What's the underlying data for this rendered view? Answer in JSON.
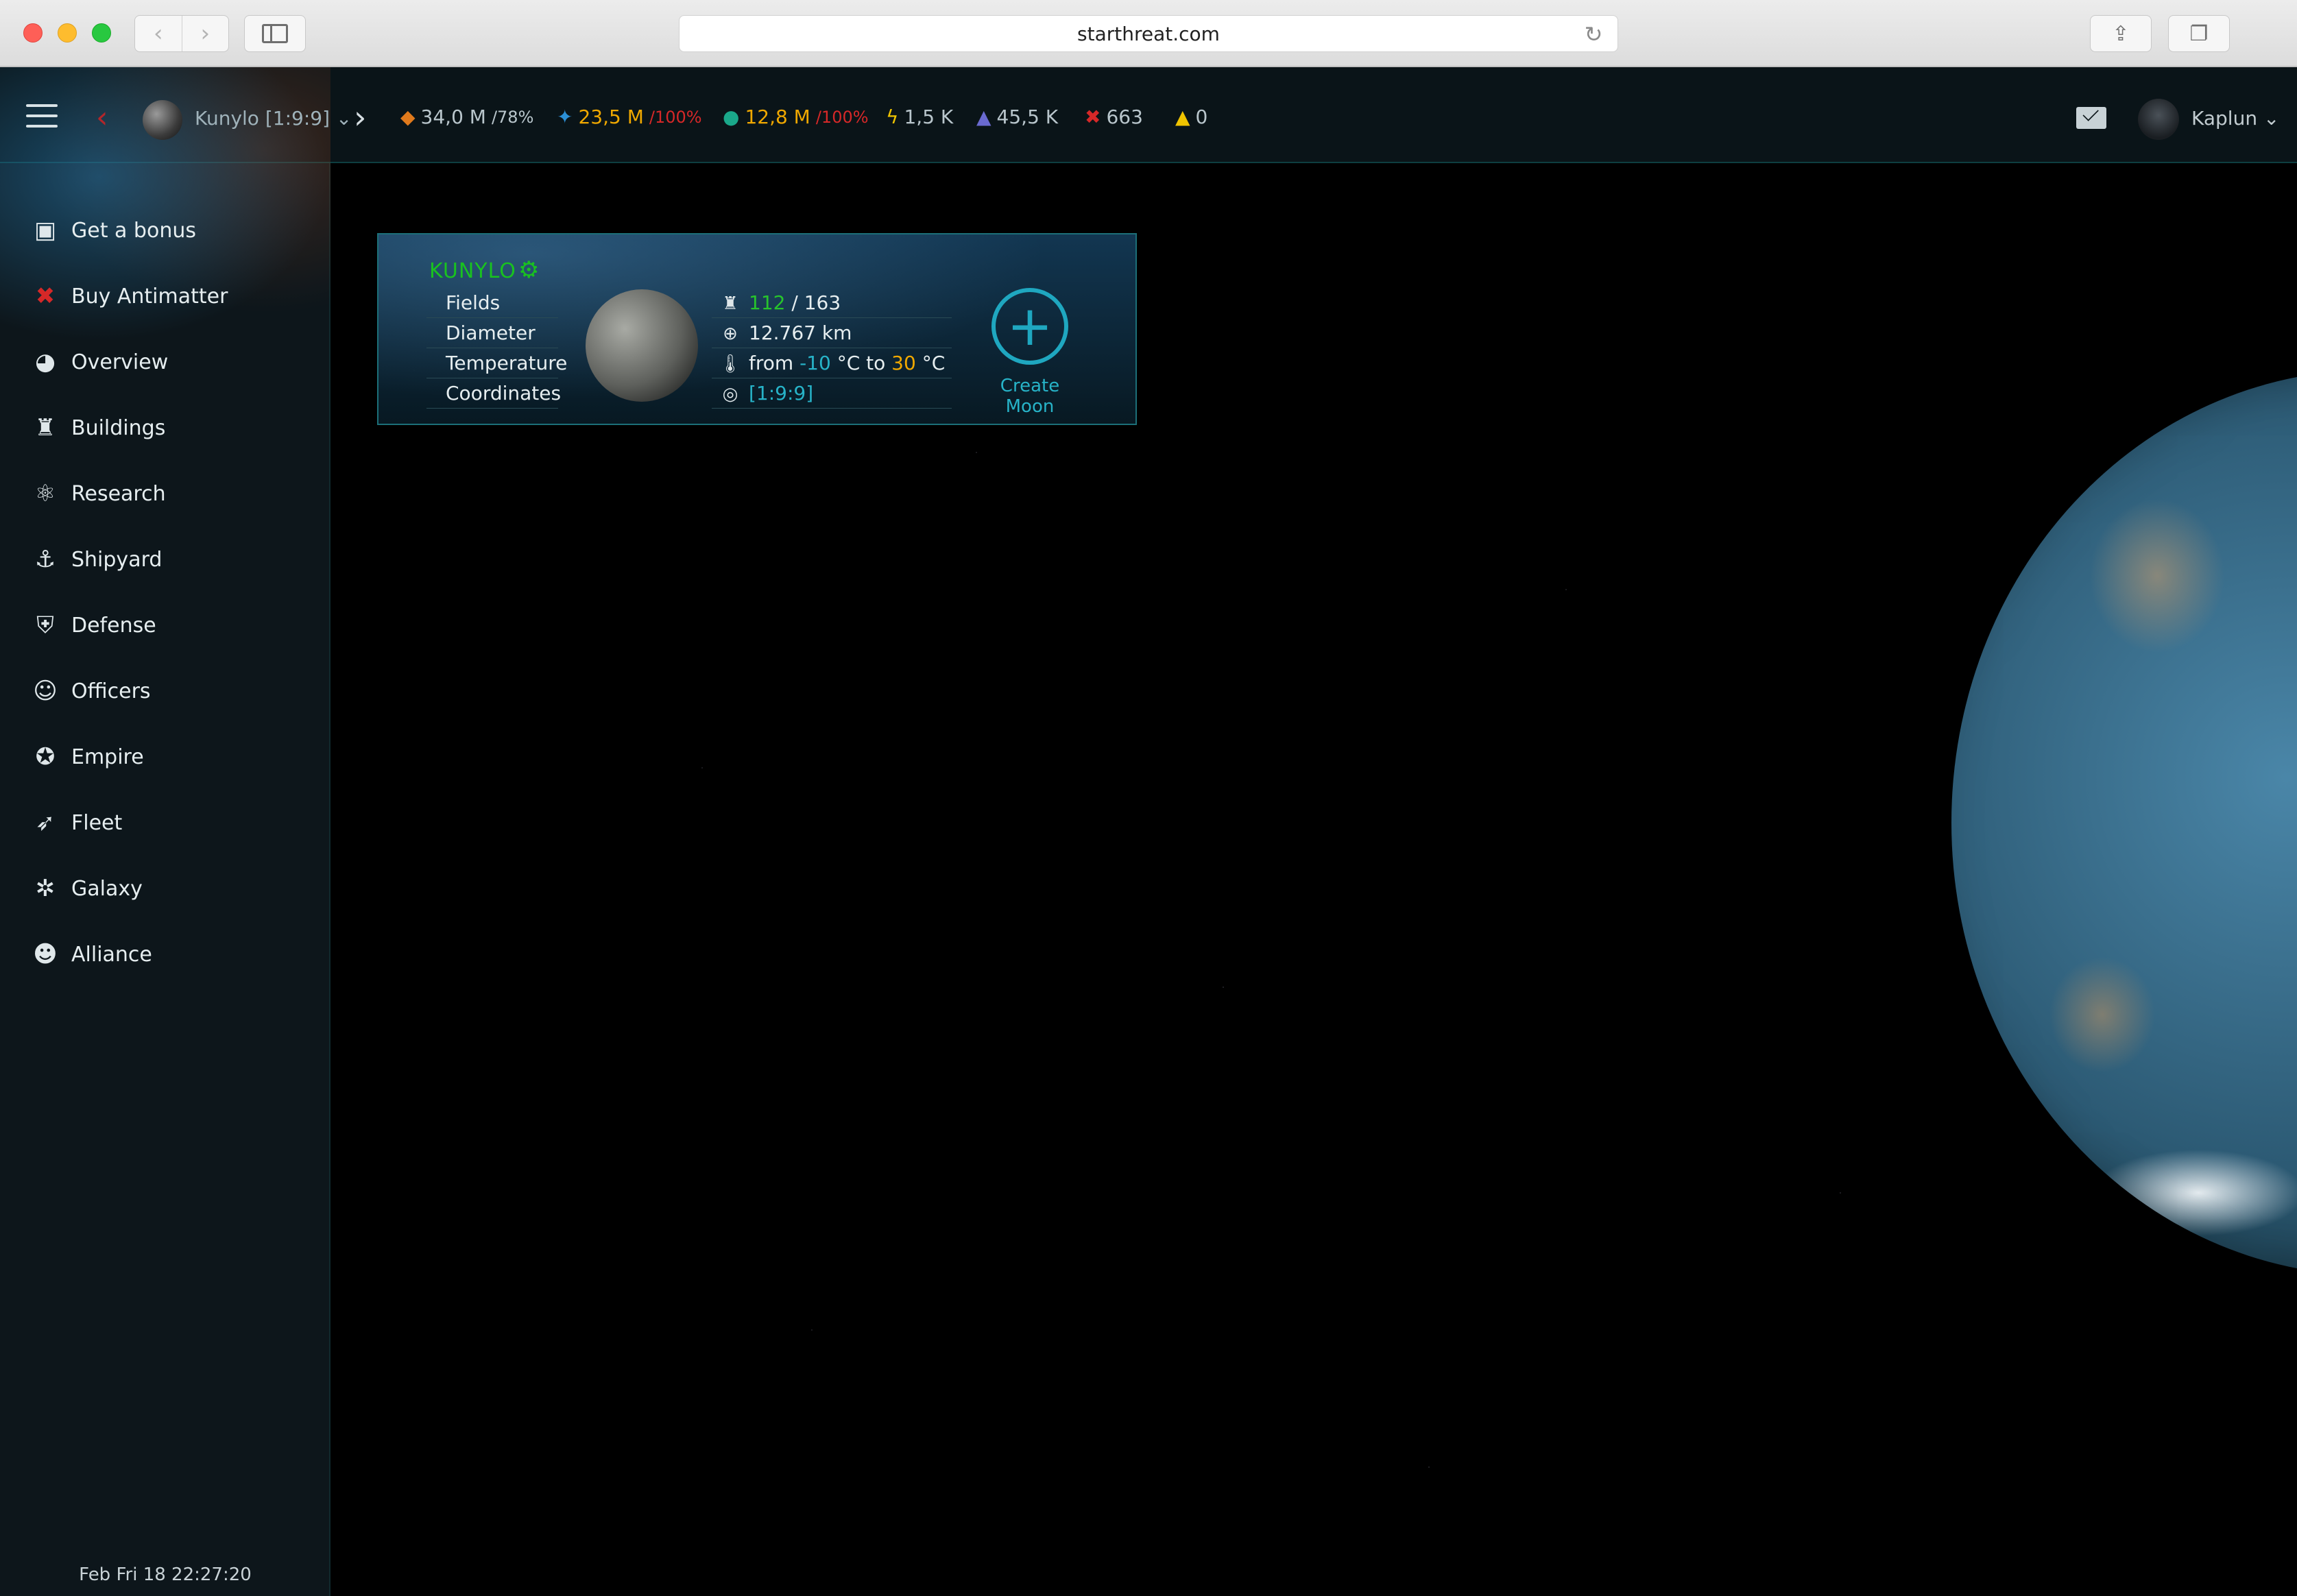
{
  "browser": {
    "url": "starthreat.com",
    "icons": [
      "back-arrow-icon",
      "forward-arrow-icon",
      "sidebar-toggle-icon",
      "reload-icon",
      "share-icon",
      "tabs-icon"
    ]
  },
  "topbar": {
    "planet_selector": "Kunylo [1:9:9]",
    "resources": {
      "metal": {
        "value": "34,0 M",
        "pct": "/78%"
      },
      "crystal": {
        "value": "23,5 M",
        "pct": "/100%"
      },
      "deuterium": {
        "value": "12,8 M",
        "pct": "/100%"
      },
      "energy": {
        "value": "1,5 K"
      },
      "dark_matter": {
        "value": "45,5 K"
      },
      "antimatter": {
        "value": "663"
      },
      "alerts": {
        "value": "0"
      }
    },
    "user": {
      "name": "Kaplun"
    }
  },
  "sidebar": {
    "items": [
      {
        "label": "Get a bonus",
        "icon": "bonus-icon"
      },
      {
        "label": "Buy Antimatter",
        "icon": "antimatter-icon"
      },
      {
        "label": "Overview",
        "icon": "globe-icon"
      },
      {
        "label": "Buildings",
        "icon": "building-icon"
      },
      {
        "label": "Research",
        "icon": "research-icon"
      },
      {
        "label": "Shipyard",
        "icon": "shipyard-icon"
      },
      {
        "label": "Defense",
        "icon": "defense-icon"
      },
      {
        "label": "Officers",
        "icon": "officer-icon"
      },
      {
        "label": "Empire",
        "icon": "empire-icon"
      },
      {
        "label": "Fleet",
        "icon": "rocket-icon"
      },
      {
        "label": "Galaxy",
        "icon": "galaxy-icon"
      },
      {
        "label": "Alliance",
        "icon": "alliance-icon"
      }
    ],
    "clock": "Feb Fri 18 22:27:20"
  },
  "planet_card": {
    "name": "KUNYLO",
    "labels": {
      "fields": "Fields",
      "diameter": "Diameter",
      "temperature": "Temperature",
      "coordinates": "Coordinates"
    },
    "fields_used": "112",
    "fields_sep": " / ",
    "fields_total": "163",
    "diameter": "12.767 km",
    "temp_from_text": "from ",
    "temp_min": "-10",
    "temp_mid_text": " °C to ",
    "temp_max": "30",
    "temp_unit": " °C",
    "coordinates": "[1:9:9]",
    "create_moon": "Create Moon"
  }
}
